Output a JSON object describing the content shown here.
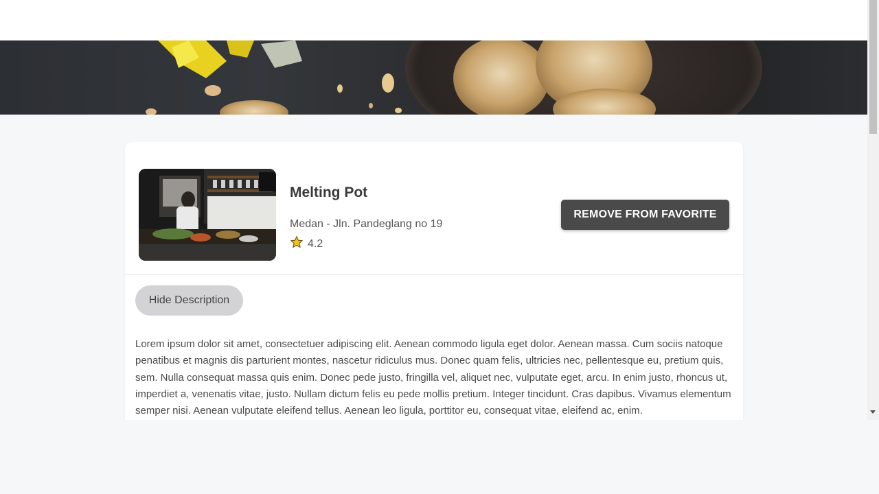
{
  "restaurant": {
    "name": "Melting Pot",
    "city": "Medan",
    "address": "Jln. Pandeglang no 19",
    "address_line": "Medan - Jln. Pandeglang no 19",
    "rating": "4.2"
  },
  "actions": {
    "remove_favorite_label": "REMOVE FROM FAVORITE",
    "toggle_description_label": "Hide Description"
  },
  "description": "Lorem ipsum dolor sit amet, consectetuer adipiscing elit. Aenean commodo ligula eget dolor. Aenean massa. Cum sociis natoque penatibus et magnis dis parturient montes, nascetur ridiculus mus. Donec quam felis, ultricies nec, pellentesque eu, pretium quis, sem. Nulla consequat massa quis enim. Donec pede justo, fringilla vel, aliquet nec, vulputate eget, arcu. In enim justo, rhoncus ut, imperdiet a, venenatis vitae, justo. Nullam dictum felis eu pede mollis pretium. Integer tincidunt. Cras dapibus. Vivamus elementum semper nisi. Aenean vulputate eleifend tellus. Aenean leo ligula, porttitor eu, consequat vitae, eleifend ac, enim.",
  "icons": {
    "rating": "star-icon",
    "scroll_down": "chevron-down-icon"
  },
  "colors": {
    "primary_button": "#4a4a4a",
    "secondary_button": "#d3d3d6",
    "star": "#f2c21b",
    "page_background": "#f6f7f9"
  }
}
